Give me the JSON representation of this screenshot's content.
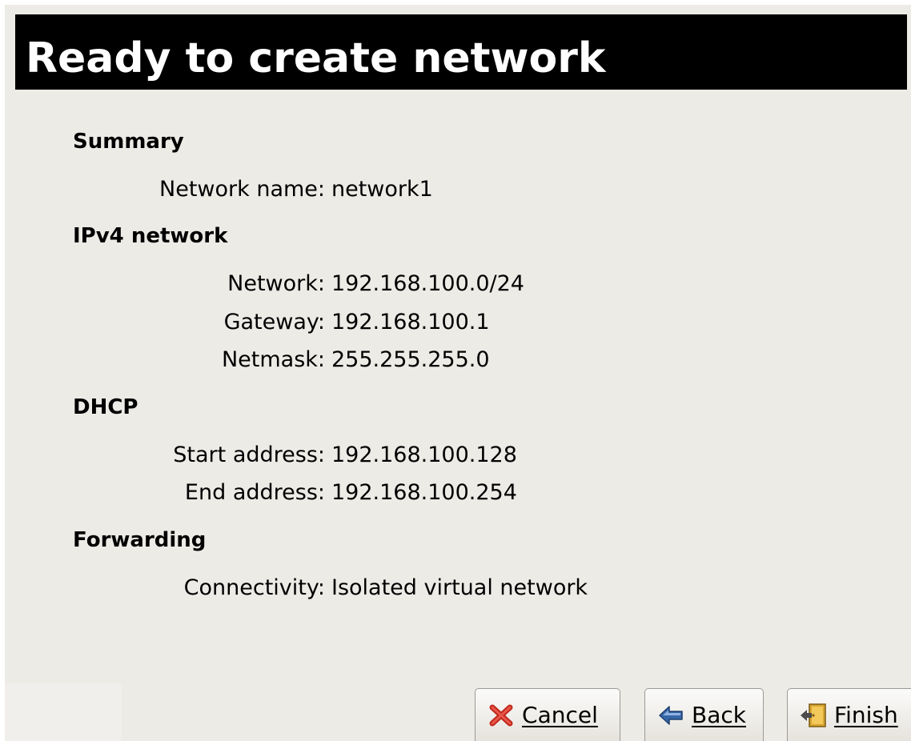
{
  "header": {
    "title": "Ready to create network"
  },
  "sections": {
    "summary": {
      "title": "Summary",
      "network_name_label": "Network name:",
      "network_name_value": "network1"
    },
    "ipv4": {
      "title": "IPv4 network",
      "network_label": "Network:",
      "network_value": "192.168.100.0/24",
      "gateway_label": "Gateway:",
      "gateway_value": "192.168.100.1",
      "netmask_label": "Netmask:",
      "netmask_value": "255.255.255.0"
    },
    "dhcp": {
      "title": "DHCP",
      "start_label": "Start address:",
      "start_value": "192.168.100.128",
      "end_label": "End address:",
      "end_value": "192.168.100.254"
    },
    "forwarding": {
      "title": "Forwarding",
      "connectivity_label": "Connectivity:",
      "connectivity_value": "Isolated virtual network"
    }
  },
  "buttons": {
    "cancel": {
      "label": "Cancel",
      "icon": "cancel-x-icon"
    },
    "back": {
      "label": "Back",
      "icon": "back-arrow-icon"
    },
    "finish": {
      "label": "Finish",
      "icon": "finish-door-icon"
    }
  },
  "colors": {
    "header_bg": "#000000",
    "header_text": "#ffffff",
    "window_bg": "#edebe6",
    "cancel_red": "#c0271a",
    "back_blue": "#3566a8",
    "finish_gold": "#d9a531"
  }
}
